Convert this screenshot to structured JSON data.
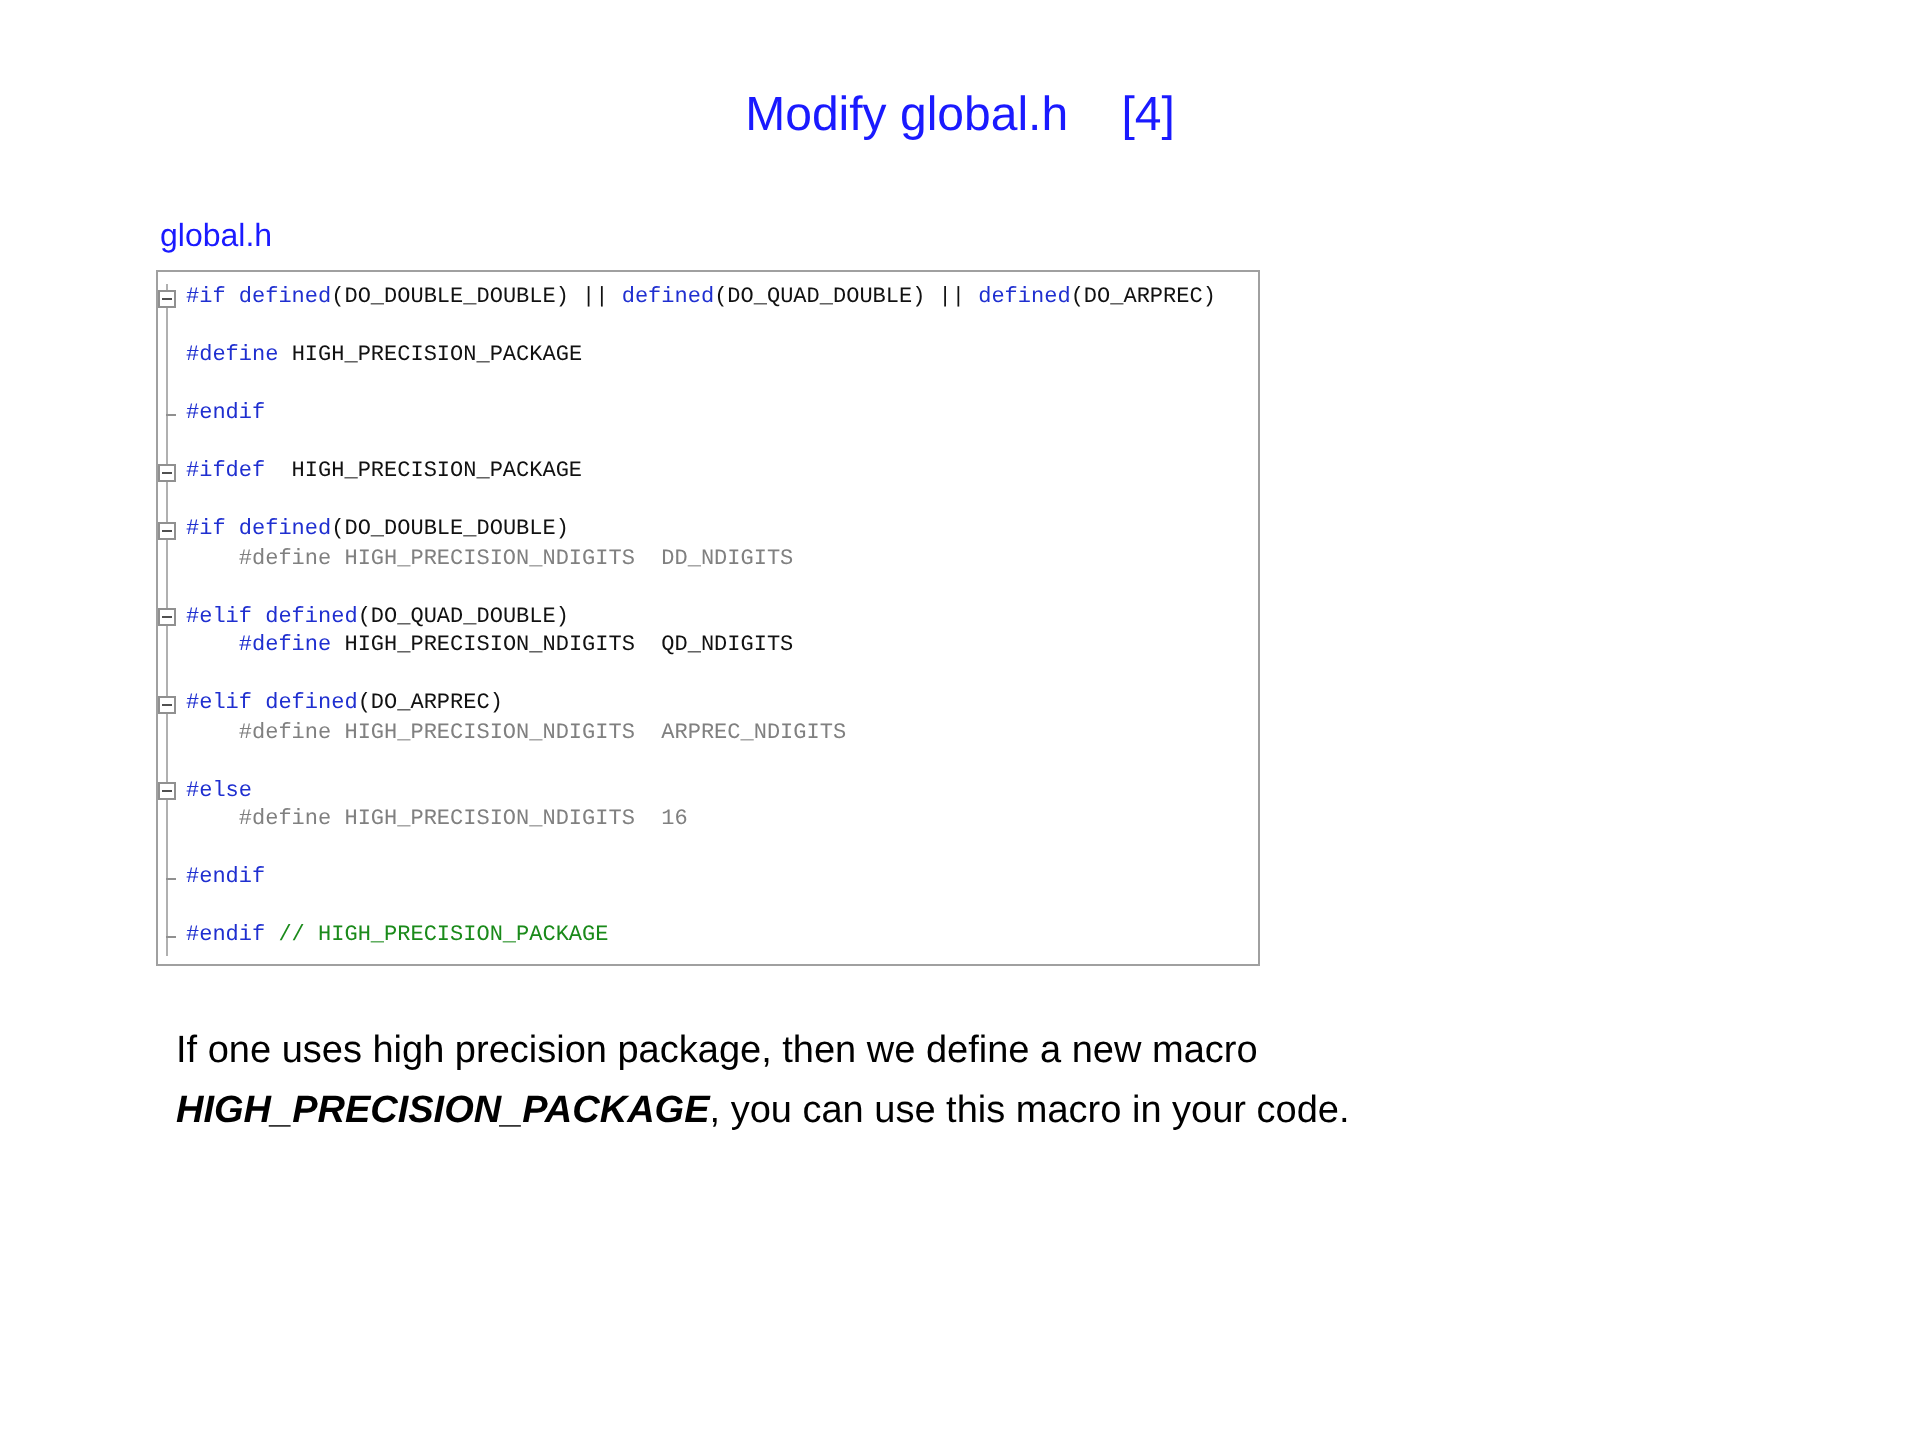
{
  "slide": {
    "title": "Modify global.h    [4]",
    "file_label": "global.h",
    "code_blocks": [
      {
        "kind": "fold_start",
        "lines": [
          [
            {
              "kind": "keyword",
              "text": "#if defined"
            },
            {
              "kind": "plain",
              "text": "(DO_DOUBLE_DOUBLE) || "
            },
            {
              "kind": "keyword",
              "text": "defined"
            },
            {
              "kind": "plain",
              "text": "(DO_QUAD_DOUBLE) || "
            },
            {
              "kind": "keyword",
              "text": "defined"
            },
            {
              "kind": "plain",
              "text": "(DO_ARPREC)"
            }
          ]
        ]
      },
      {
        "kind": "plain",
        "lines": [
          [
            {
              "kind": "keyword",
              "text": "#define"
            },
            {
              "kind": "plain",
              "text": " HIGH_PRECISION_PACKAGE"
            }
          ]
        ]
      },
      {
        "kind": "fold_end",
        "lines": [
          [
            {
              "kind": "keyword",
              "text": "#endif"
            }
          ]
        ]
      },
      {
        "kind": "fold_start",
        "lines": [
          [
            {
              "kind": "keyword",
              "text": "#ifdef"
            },
            {
              "kind": "plain",
              "text": "  HIGH_PRECISION_PACKAGE"
            }
          ]
        ]
      },
      {
        "kind": "fold_start",
        "lines": [
          [
            {
              "kind": "keyword",
              "text": "#if defined"
            },
            {
              "kind": "plain",
              "text": "(DO_DOUBLE_DOUBLE)"
            }
          ],
          [
            {
              "kind": "inactive",
              "text": "    #define HIGH_PRECISION_NDIGITS  DD_NDIGITS"
            }
          ]
        ]
      },
      {
        "kind": "fold_start",
        "lines": [
          [
            {
              "kind": "keyword",
              "text": "#elif defined"
            },
            {
              "kind": "plain",
              "text": "(DO_QUAD_DOUBLE)"
            }
          ],
          [
            {
              "kind": "keyword",
              "text": "    #define"
            },
            {
              "kind": "plain",
              "text": " HIGH_PRECISION_NDIGITS  QD_NDIGITS"
            }
          ]
        ]
      },
      {
        "kind": "fold_start",
        "lines": [
          [
            {
              "kind": "keyword",
              "text": "#elif defined"
            },
            {
              "kind": "plain",
              "text": "(DO_ARPREC)"
            }
          ],
          [
            {
              "kind": "inactive",
              "text": "    #define HIGH_PRECISION_NDIGITS  ARPREC_NDIGITS"
            }
          ]
        ]
      },
      {
        "kind": "fold_start",
        "lines": [
          [
            {
              "kind": "keyword",
              "text": "#else"
            }
          ],
          [
            {
              "kind": "inactive",
              "text": "    #define HIGH_PRECISION_NDIGITS  16"
            }
          ]
        ]
      },
      {
        "kind": "fold_end",
        "lines": [
          [
            {
              "kind": "keyword",
              "text": "#endif"
            }
          ]
        ]
      },
      {
        "kind": "fold_end",
        "lines": [
          [
            {
              "kind": "keyword",
              "text": "#endif"
            },
            {
              "kind": "comment",
              "text": " // HIGH_PRECISION_PACKAGE"
            }
          ]
        ]
      }
    ],
    "note": "If one uses high precision package, then we define a new macro **HIGH_PRECISION_PACKAGE**, you can use this macro in your code."
  }
}
